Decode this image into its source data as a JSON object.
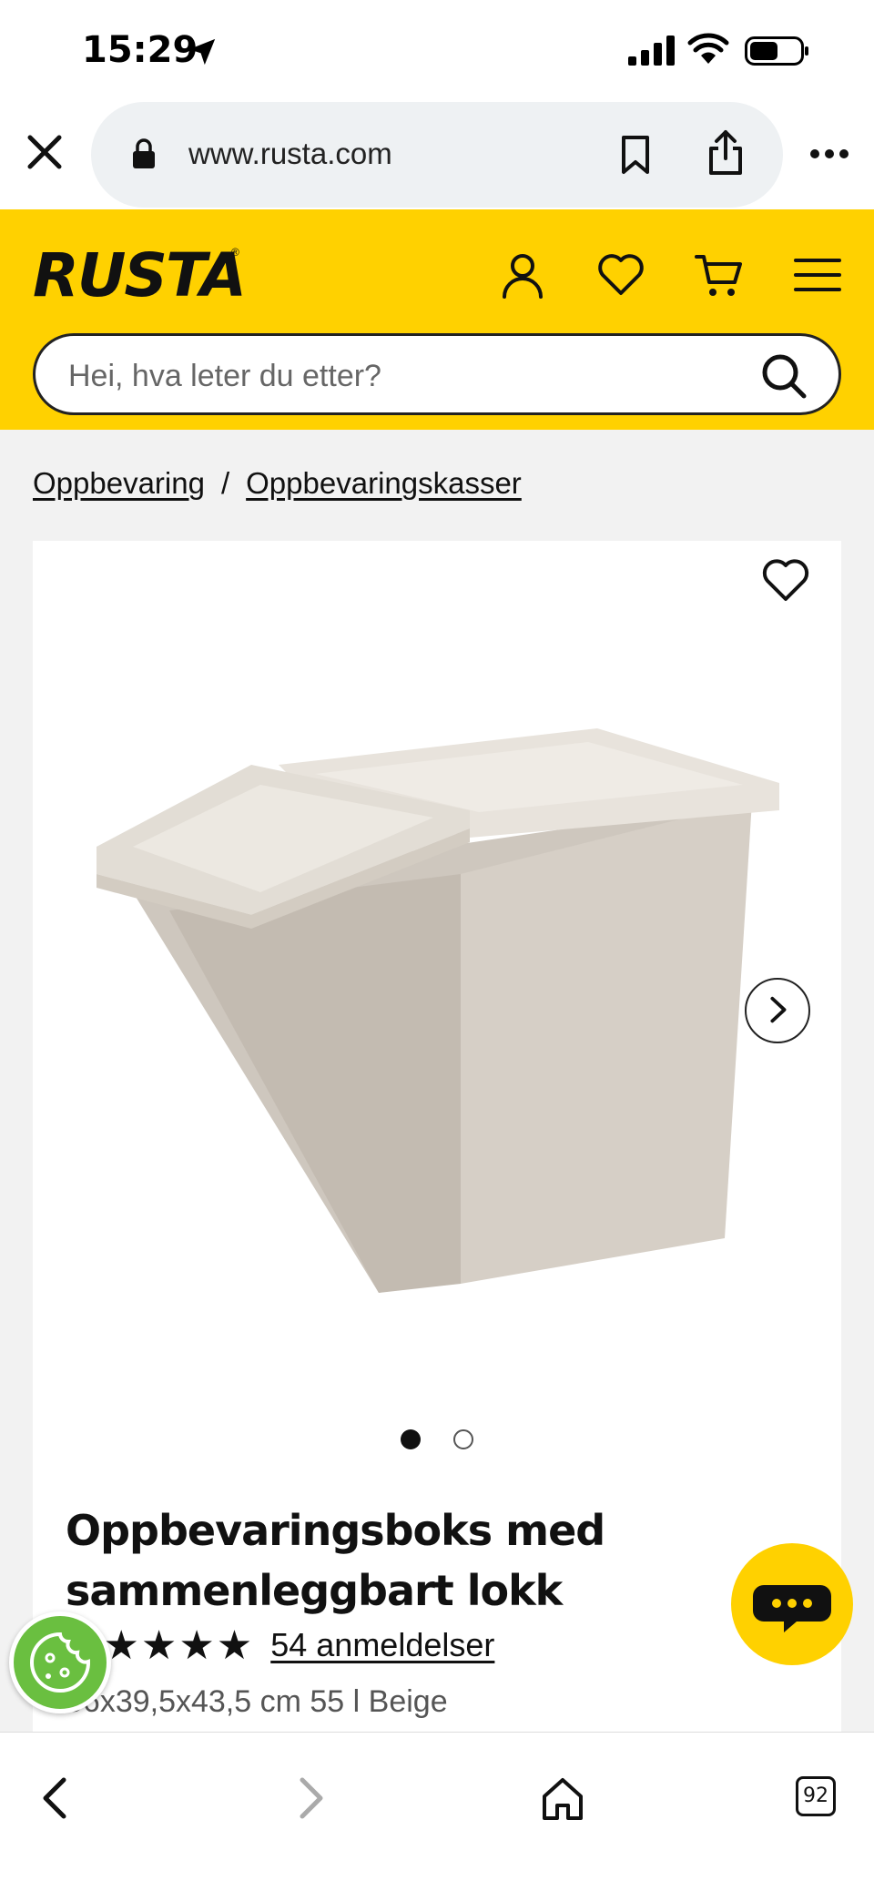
{
  "status_bar": {
    "time": "15:29"
  },
  "browser": {
    "url": "www.rusta.com",
    "tabs_count": "92"
  },
  "header": {
    "logo": "RUSTA",
    "logo_mark": "®",
    "search_placeholder": "Hei, hva leter du etter?",
    "accent_color": "#ffd100"
  },
  "breadcrumb": {
    "items": [
      "Oppbevaring",
      "Oppbevaringskasser"
    ],
    "separator": "/"
  },
  "product": {
    "title_line1": "Oppbevaringsboks med",
    "title_line2": "sammenleggbart lokk",
    "stars": "★★★★★",
    "reviews": "54 anmeldelser",
    "specs": "56x39,5x43,5 cm 55 l Beige",
    "image_count": 2,
    "active_image": 1
  },
  "icons": {
    "account": "user-icon",
    "wishlist": "heart-icon",
    "cart": "cart-icon",
    "menu": "hamburger-icon",
    "chat": "chat-icon",
    "cookie": "cookie-icon"
  }
}
